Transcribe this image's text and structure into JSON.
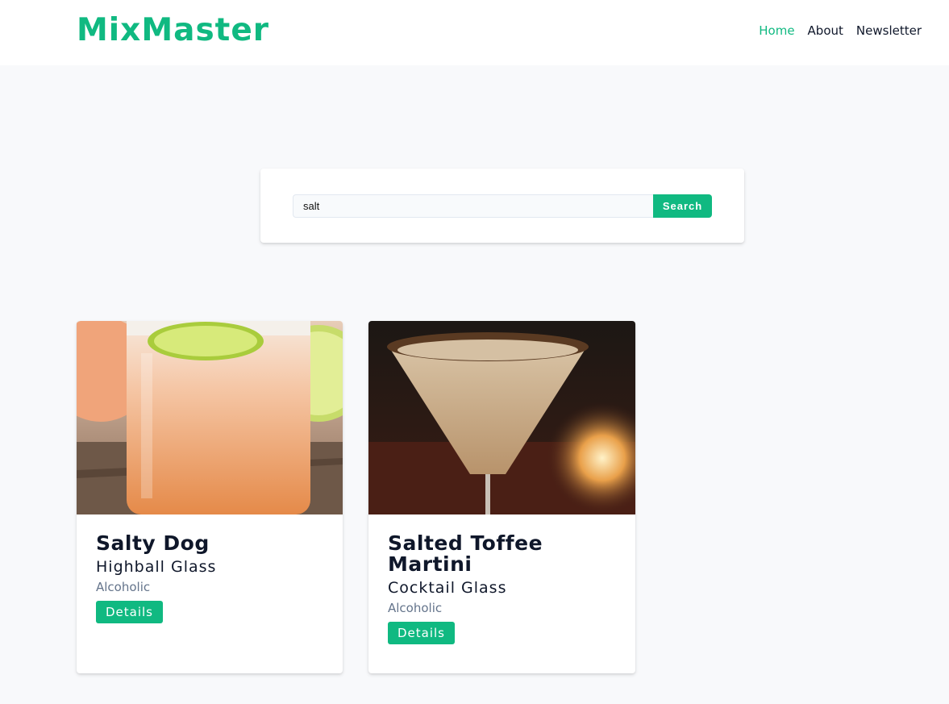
{
  "brand": {
    "name": "MixMaster",
    "accent": "#10b981"
  },
  "nav": {
    "items": [
      {
        "label": "Home",
        "active": true
      },
      {
        "label": "About",
        "active": false
      },
      {
        "label": "Newsletter",
        "active": false
      }
    ]
  },
  "search": {
    "value": "salt",
    "button_label": "Search"
  },
  "cocktails": [
    {
      "name": "Salty Dog",
      "glass": "Highball Glass",
      "info": "Alcoholic",
      "button_label": "Details",
      "image": "cocktail-photo"
    },
    {
      "name": "Salted Toffee Martini",
      "glass": "Cocktail Glass",
      "info": "Alcoholic",
      "button_label": "Details",
      "image": "cocktail-photo"
    }
  ]
}
